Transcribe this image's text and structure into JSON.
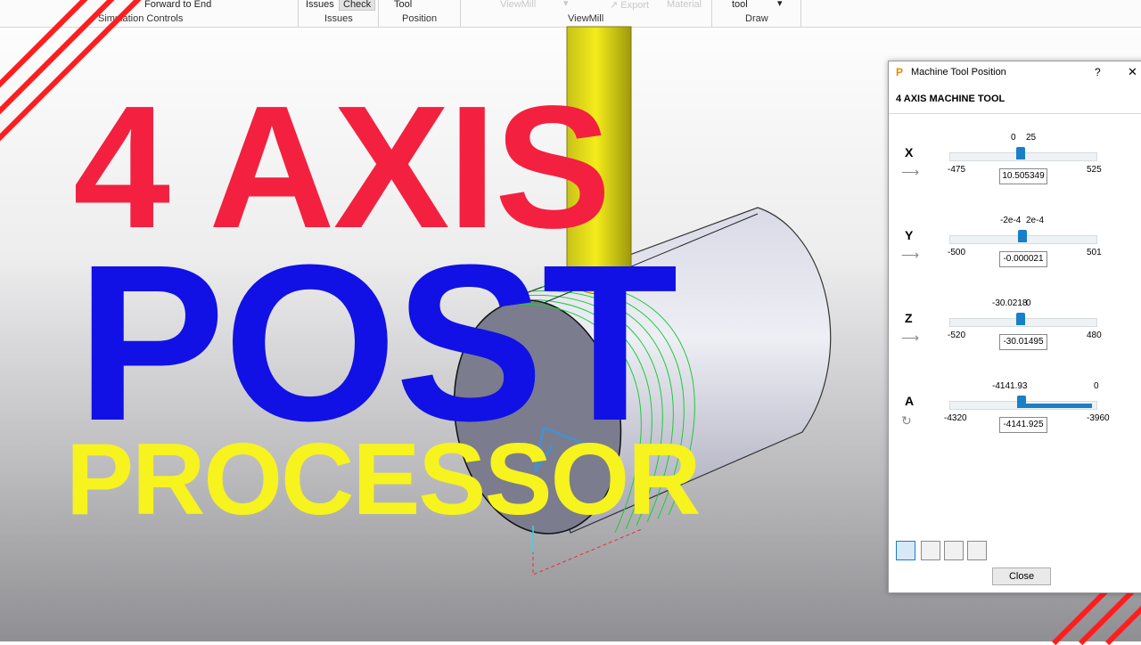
{
  "ribbon": {
    "sim_forward_label": "Forward",
    "sim_to_end_label": "to End",
    "sim_group": "Simulation Controls",
    "issues_btn": "Issues",
    "check_btn": "Check",
    "issues_group": "Issues",
    "tool_btn": "Tool",
    "position_group": "Position",
    "viewmill_btn": "ViewMill",
    "export_btn": "Export",
    "material_btn": "Material",
    "viewmill_group": "ViewMill",
    "tool_select": "tool",
    "draw_group": "Draw"
  },
  "headline": {
    "line1": "4 AXIS",
    "line2": "POST",
    "line3": "PROCESSOR"
  },
  "colors": {
    "red": "#f4203f",
    "blue": "#1111e6",
    "yellow": "#f7f31e",
    "accent": "#1a7fc6"
  },
  "dialog": {
    "title": "Machine Tool Position",
    "help": "?",
    "close_x": "✕",
    "subtitle": "4 AXIS MACHINE TOOL",
    "close_button": "Close",
    "axes": [
      {
        "name": "X",
        "min": "-475",
        "max": "525",
        "ticks": [
          "0",
          "25"
        ],
        "value": "10.505349",
        "fraction": 0.486,
        "icon": "arrow-right-icon"
      },
      {
        "name": "Y",
        "min": "-500",
        "max": "501",
        "ticks": [
          "-2e-4",
          "2e-4"
        ],
        "value": "-0.000021",
        "fraction": 0.5,
        "icon": "arrow-right-icon"
      },
      {
        "name": "Z",
        "min": "-520",
        "max": "480",
        "ticks": [
          "-30.0218",
          "0"
        ],
        "value": "-30.01495",
        "fraction": 0.49,
        "icon": "arrow-right-icon"
      },
      {
        "name": "A",
        "min": "-4320",
        "max": "-3960",
        "ticks": [
          "-4141.93",
          "0"
        ],
        "value": "-4141.925",
        "fraction": 0.495,
        "icon": "rotate-icon"
      }
    ]
  }
}
